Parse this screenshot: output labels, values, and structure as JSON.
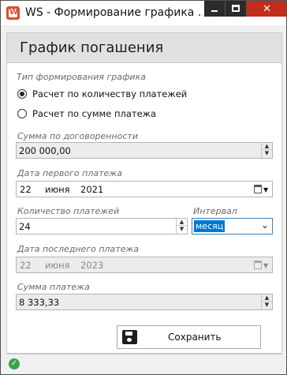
{
  "window": {
    "title": "WS - Формирование графика ...",
    "app_icon_letter": "W",
    "controls": {
      "minimize": "minimize",
      "maximize": "maximize",
      "close": "✕"
    }
  },
  "header": {
    "title": "График погашения"
  },
  "mode_group": {
    "label": "Тип формирования графика",
    "options": [
      {
        "label": "Расчет по количеству платежей",
        "checked": true
      },
      {
        "label": "Расчет по сумме платежа",
        "checked": false
      }
    ]
  },
  "contract_sum": {
    "label": "Сумма по договоренности",
    "value": "200 000,00"
  },
  "first_payment_date": {
    "label": "Дата первого платежа",
    "day": "22",
    "month": "июня",
    "year": "2021"
  },
  "payments_count": {
    "label": "Количество платежей",
    "value": "24"
  },
  "interval": {
    "label": "Интервал",
    "value": "месяц"
  },
  "last_payment_date": {
    "label": "Дата последнего платежа",
    "day": "22",
    "month": "июня",
    "year": "2023"
  },
  "payment_amount": {
    "label": "Сумма платежа",
    "value": "8 333,33"
  },
  "save_button": {
    "label": "Сохранить"
  },
  "status": {
    "icon": "check-icon",
    "color": "#3aa14a"
  },
  "colors": {
    "accent": "#0078d7",
    "close": "#c42b1c"
  }
}
